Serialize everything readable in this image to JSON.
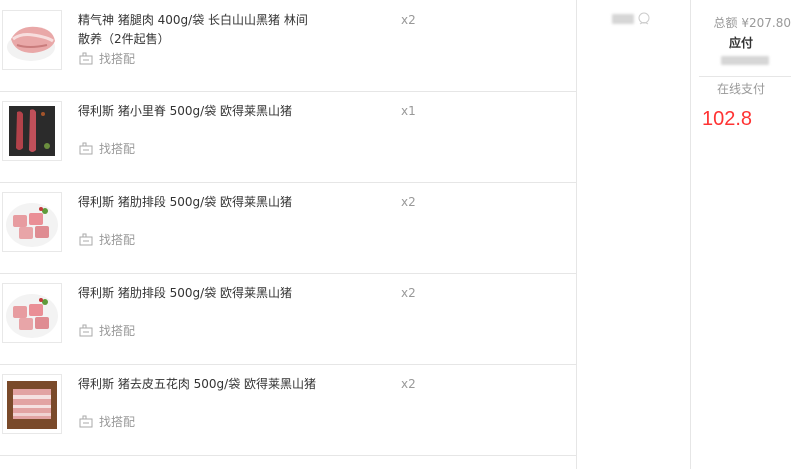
{
  "items": [
    {
      "title": "精气神 猪腿肉 400g/袋 长白山山黑猪 林间散养（2件起售）",
      "qty": "x2",
      "match_label": "找搭配",
      "image": "pork-leg-slab"
    },
    {
      "title": "得利斯 猪小里脊 500g/袋 欧得莱黑山猪",
      "qty": "x1",
      "match_label": "找搭配",
      "image": "pork-tenderloin-dark-tray"
    },
    {
      "title": "得利斯 猪肋排段 500g/袋 欧得莱黑山猪",
      "qty": "x2",
      "match_label": "找搭配",
      "image": "pork-ribs-plate"
    },
    {
      "title": "得利斯 猪肋排段 500g/袋 欧得莱黑山猪",
      "qty": "x2",
      "match_label": "找搭配",
      "image": "pork-ribs-plate"
    },
    {
      "title": "得利斯 猪去皮五花肉 500g/袋 欧得莱黑山猪",
      "qty": "x2",
      "match_label": "找搭配",
      "image": "pork-belly-board"
    }
  ],
  "summary": {
    "total_label": "总额 ¥207.80",
    "payable_label": "应付",
    "payment_method": "在线支付",
    "amount": "102.8"
  },
  "colors": {
    "accent_red": "#ff3333",
    "muted": "#999999",
    "border": "#e6e6e6"
  }
}
